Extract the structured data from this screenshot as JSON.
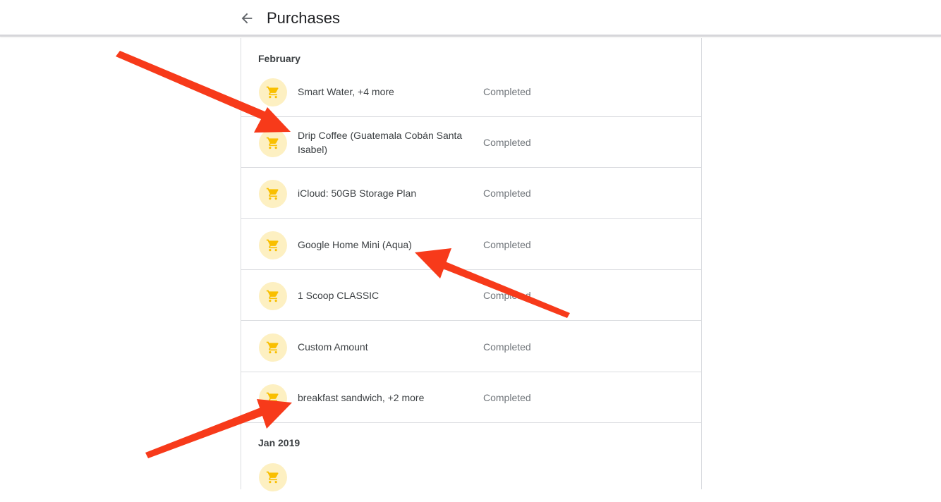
{
  "header": {
    "title": "Purchases",
    "back_icon": "arrow-back-icon"
  },
  "sections": [
    {
      "label": "February",
      "items": [
        {
          "name": "Smart Water, +4 more",
          "status": "Completed"
        },
        {
          "name": "Drip Coffee (Guatemala Cobán Santa Isabel)",
          "status": "Completed"
        },
        {
          "name": "iCloud: 50GB Storage Plan",
          "status": "Completed"
        },
        {
          "name": "Google Home Mini (Aqua)",
          "status": "Completed"
        },
        {
          "name": "1 Scoop CLASSIC",
          "status": "Completed"
        },
        {
          "name": "Custom Amount",
          "status": "Completed"
        },
        {
          "name": "breakfast sandwich, +2 more",
          "status": "Completed"
        }
      ]
    },
    {
      "label": "Jan 2019",
      "items": []
    }
  ],
  "colors": {
    "icon_bg": "#fdf0c2",
    "icon_fg": "#f9bf00",
    "annotation_arrow": "#f73a1a",
    "divider": "#dadce0"
  },
  "icons": {
    "row_icon": "shopping-cart-icon"
  }
}
